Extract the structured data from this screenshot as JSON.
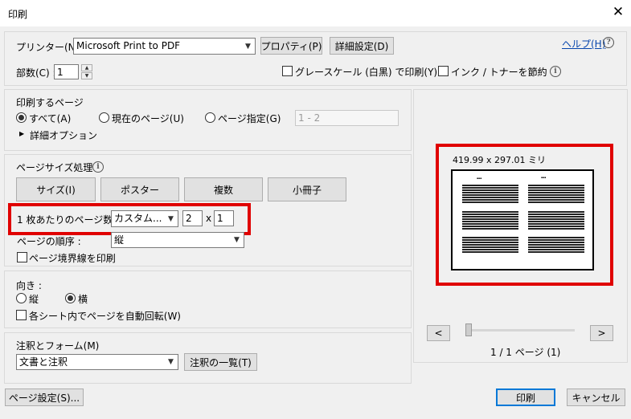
{
  "window": {
    "title": "印刷",
    "close_glyph": "✕"
  },
  "printer": {
    "label": "プリンター(N) :",
    "value": "Microsoft Print to PDF",
    "properties_button": "プロパティ(P)",
    "advanced_button": "詳細設定(D)",
    "help_link": "ヘルプ(H)",
    "help_icon": "?"
  },
  "copies": {
    "label": "部数(C) :",
    "value": "1"
  },
  "grayscale": {
    "label": "グレースケール (白黒) で印刷(Y)",
    "checked": false
  },
  "save_ink": {
    "label": "インク / トナーを節約",
    "checked": false
  },
  "pages_to_print": {
    "heading": "印刷するページ",
    "all": "すべて(A)",
    "current": "現在のページ(U)",
    "range": "ページ指定(G)",
    "range_value": "1 - 2",
    "more_options": "詳細オプション",
    "selected": "all"
  },
  "page_sizing": {
    "heading": "ページサイズ処理",
    "size_button": "サイズ(I)",
    "poster_button": "ポスター",
    "multiple_button": "複数",
    "booklet_button": "小冊子",
    "pages_per_sheet_label": "1 枚あたりのページ数 :",
    "pages_per_sheet_value": "カスタム...",
    "cols": "2",
    "times": "x",
    "rows": "1",
    "page_order_label": "ページの順序 :",
    "page_order_value": "縦",
    "print_borders": "ページ境界線を印刷"
  },
  "orientation": {
    "heading": "向き :",
    "portrait": "縦",
    "landscape": "横",
    "selected": "landscape",
    "auto_rotate": "各シート内でページを自動回転(W)"
  },
  "comments": {
    "heading": "注釈とフォーム(M)",
    "value": "文書と注釈",
    "summarize_button": "注釈の一覧(T)"
  },
  "preview": {
    "dimensions": "419.99 x 297.01 ミリ",
    "prev": "<",
    "next": ">",
    "page_indicator": "1 / 1 ページ (1)"
  },
  "footer": {
    "page_setup_button": "ページ設定(S)...",
    "print_button": "印刷",
    "cancel_button": "キャンセル"
  },
  "colors": {
    "highlight": "#e00000",
    "link": "#0645ad",
    "accent": "#0078d7"
  },
  "icons": {
    "info": "info-icon",
    "dropdown": "chevron-down-icon",
    "expand": "triangle-right-icon"
  }
}
